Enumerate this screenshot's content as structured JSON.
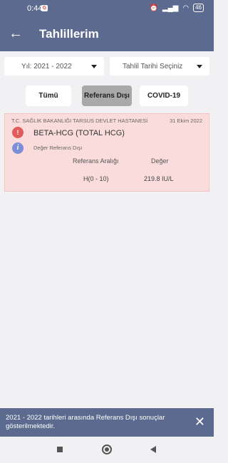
{
  "status_bar": {
    "time": "0:44",
    "g_icon_letter": "G",
    "battery": "46"
  },
  "app_bar": {
    "back_icon": "arrow-left-icon",
    "title": "Tahlillerim"
  },
  "filters": {
    "year": "Yıl: 2021 - 2022",
    "date": "Tahlil Tarihi Seçiniz"
  },
  "tabs": [
    {
      "label": "Tümü",
      "active": false
    },
    {
      "label": "Referans Dışı",
      "active": true
    },
    {
      "label": "COVID-19",
      "active": false
    }
  ],
  "result_card": {
    "hospital": "T.C. SAĞLIK BAKANLIĞI TARSUS DEVLET HASTANESİ",
    "date": "31 Ekim 2022",
    "warning_icon_text": "!",
    "info_icon_text": "i",
    "test_name": "BETA-HCG (TOTAL HCG)",
    "status": "Değer Referans Dışı",
    "columns": [
      "Referans Aralığı",
      "Değer"
    ],
    "row": [
      "H(0 - 10)",
      "219.8 IU/L"
    ],
    "background": "#fbdcdc"
  },
  "snackbar": {
    "message": "2021 - 2022 tarihleri arasında Referans Dışı sonuçlar gösterilmektedir.",
    "close": "✕"
  },
  "colors": {
    "primary": "#5c6a8f",
    "warning": "#e25b5b",
    "info": "#7a8fd6"
  }
}
